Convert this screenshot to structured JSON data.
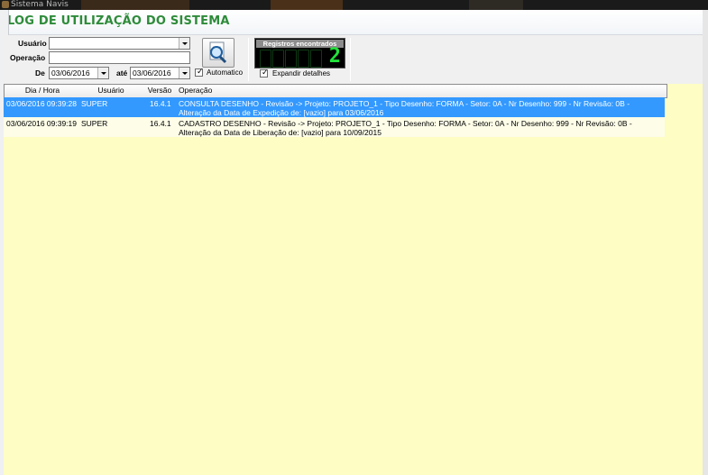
{
  "window": {
    "title": "Sistema Navis"
  },
  "header": {
    "title": "LOG DE UTILIZAÇÃO DO SISTEMA"
  },
  "filters": {
    "usuario_label": "Usuário",
    "usuario_value": "",
    "operacao_label": "Operação",
    "operacao_value": "",
    "de_label": "De",
    "de_value": "03/06/2016",
    "ate_label": "até",
    "ate_value": "03/06/2016",
    "automatico_label": "Automatico",
    "automatico_checked": true,
    "expandir_label": "Expandir detalhes",
    "expandir_checked": true
  },
  "counter": {
    "label": "Registros encontrados",
    "value": "2"
  },
  "grid": {
    "columns": [
      "Dia / Hora",
      "Usuário",
      "Versão",
      "Operação"
    ],
    "rows": [
      {
        "datetime": "03/06/2016 09:39:28",
        "user": "SUPER",
        "version": "16.4.1",
        "operation": "CONSULTA DESENHO - Revisão -> Projeto: PROJETO_1 - Tipo Desenho: FORMA - Setor: 0A - Nr Desenho: 999 - Nr Revisão: 0B - Alteração da Data de Expedição de:  [vazio] para 03/06/2016",
        "selected": true
      },
      {
        "datetime": "03/06/2016 09:39:19",
        "user": "SUPER",
        "version": "16.4.1",
        "operation": "CADASTRO DESENHO - Revisão -> Projeto: PROJETO_1 - Tipo Desenho: FORMA - Setor: 0A - Nr Desenho: 999 - Nr Revisão: 0B - Alteração da Data de Liberação de:  [vazio] para 10/09/2015",
        "selected": false
      }
    ]
  },
  "colors": {
    "title_green": "#2e8b3a",
    "grid_bg": "#fdfdc4",
    "selection": "#3399ff",
    "counter_digit": "#21e23a"
  }
}
